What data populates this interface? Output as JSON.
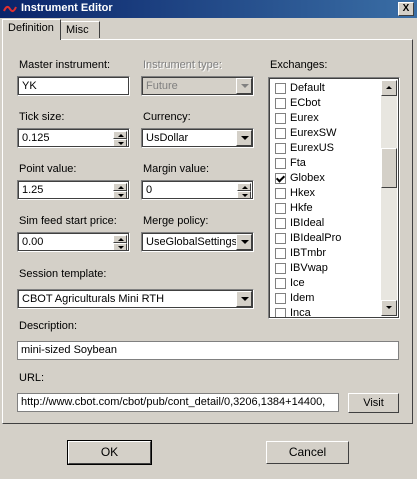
{
  "window": {
    "title": "Instrument Editor",
    "close_glyph": "X"
  },
  "tabs": [
    "Definition",
    "Misc"
  ],
  "fields": {
    "master_instrument": {
      "label": "Master instrument:",
      "value": "YK"
    },
    "instrument_type": {
      "label": "Instrument type:",
      "value": "Future"
    },
    "tick_size": {
      "label": "Tick size:",
      "value": "0.125"
    },
    "currency": {
      "label": "Currency:",
      "value": "UsDollar"
    },
    "point_value": {
      "label": "Point value:",
      "value": "1.25"
    },
    "margin_value": {
      "label": "Margin value:",
      "value": "0"
    },
    "sim_feed_start_price": {
      "label": "Sim feed start price:",
      "value": "0.00"
    },
    "merge_policy": {
      "label": "Merge policy:",
      "value": "UseGlobalSettings"
    },
    "session_template": {
      "label": "Session template:",
      "value": "CBOT Agriculturals Mini RTH"
    },
    "description": {
      "label": "Description:",
      "value": "mini-sized Soybean"
    },
    "url": {
      "label": "URL:",
      "value": "http://www.cbot.com/cbot/pub/cont_detail/0,3206,1384+14400,"
    }
  },
  "exchanges": {
    "label": "Exchanges:",
    "items": [
      {
        "name": "Default",
        "checked": false
      },
      {
        "name": "ECbot",
        "checked": false
      },
      {
        "name": "Eurex",
        "checked": false
      },
      {
        "name": "EurexSW",
        "checked": false
      },
      {
        "name": "EurexUS",
        "checked": false
      },
      {
        "name": "Fta",
        "checked": false
      },
      {
        "name": "Globex",
        "checked": true
      },
      {
        "name": "Hkex",
        "checked": false
      },
      {
        "name": "Hkfe",
        "checked": false
      },
      {
        "name": "IBIdeal",
        "checked": false
      },
      {
        "name": "IBIdealPro",
        "checked": false
      },
      {
        "name": "IBTmbr",
        "checked": false
      },
      {
        "name": "IBVwap",
        "checked": false
      },
      {
        "name": "Ice",
        "checked": false
      },
      {
        "name": "Idem",
        "checked": false
      },
      {
        "name": "Inca",
        "checked": false
      }
    ]
  },
  "buttons": {
    "visit": "Visit",
    "ok": "OK",
    "cancel": "Cancel"
  }
}
